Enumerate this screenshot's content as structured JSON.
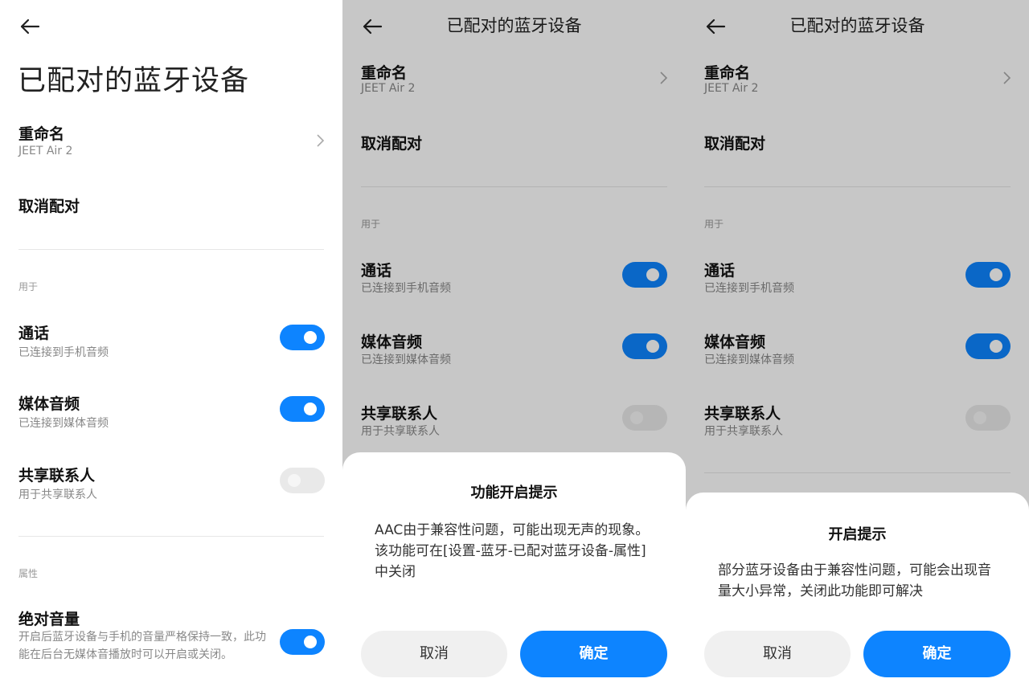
{
  "screens": [
    {
      "title": "已配对的蓝牙设备",
      "rename": {
        "label": "重命名",
        "value": "JEET Air 2"
      },
      "unpair": "取消配对",
      "section_use": "用于",
      "call": {
        "label": "通话",
        "sub": "已连接到手机音频",
        "on": true
      },
      "media": {
        "label": "媒体音频",
        "sub": "已连接到媒体音频",
        "on": true
      },
      "contacts": {
        "label": "共享联系人",
        "sub": "用于共享联系人",
        "on": false
      },
      "section_props": "属性",
      "absvol": {
        "label": "绝对音量",
        "sub": "开启后蓝牙设备与手机的音量严格保持一致，此功能在后台无媒体音播放时可以开启或关闭。",
        "on": true
      }
    },
    {
      "title": "已配对的蓝牙设备",
      "rename": {
        "label": "重命名",
        "value": "JEET Air 2"
      },
      "unpair": "取消配对",
      "section_use": "用于",
      "call": {
        "label": "通话",
        "sub": "已连接到手机音频",
        "on": true
      },
      "media": {
        "label": "媒体音频",
        "sub": "已连接到媒体音频",
        "on": true
      },
      "contacts": {
        "label": "共享联系人",
        "sub": "用于共享联系人",
        "on": false
      },
      "dialog": {
        "title": "功能开启提示",
        "message": "AAC由于兼容性问题，可能出现无声的现象。\n该功能可在[设置-蓝牙-已配对蓝牙设备-属性]中关闭",
        "cancel": "取消",
        "confirm": "确定"
      }
    },
    {
      "title": "已配对的蓝牙设备",
      "rename": {
        "label": "重命名",
        "value": "JEET Air 2"
      },
      "unpair": "取消配对",
      "section_use": "用于",
      "call": {
        "label": "通话",
        "sub": "已连接到手机音频",
        "on": true
      },
      "media": {
        "label": "媒体音频",
        "sub": "已连接到媒体音频",
        "on": true
      },
      "contacts": {
        "label": "共享联系人",
        "sub": "用于共享联系人",
        "on": false
      },
      "dialog": {
        "title": "开启提示",
        "message": "部分蓝牙设备由于兼容性问题，可能会出现音量大小异常，关闭此功能即可解决",
        "cancel": "取消",
        "confirm": "确定"
      }
    }
  ],
  "colors": {
    "accent": "#0d84ff",
    "toggle_off": "#e9e9e9",
    "overlay": "rgba(0,0,0,0.22)"
  },
  "icons": {
    "back": "arrow-left-icon",
    "chevron": "chevron-right-icon"
  }
}
